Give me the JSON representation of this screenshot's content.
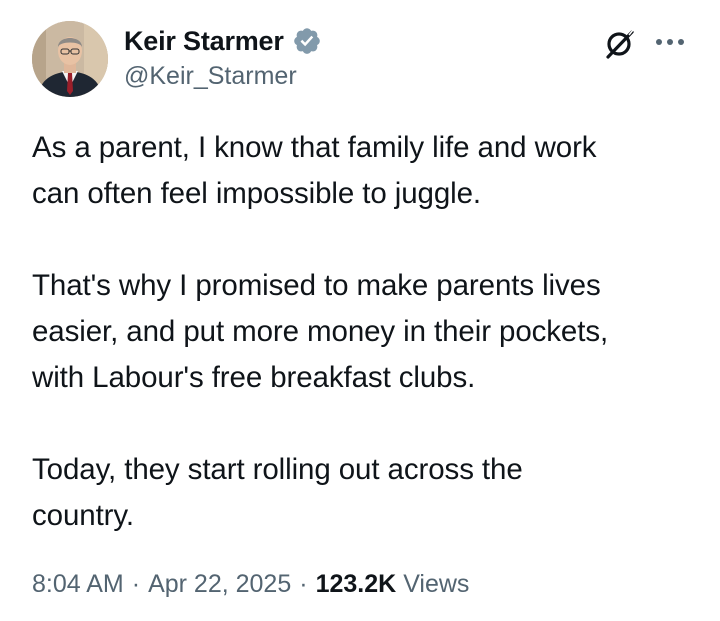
{
  "author": {
    "display_name": "Keir Starmer",
    "handle": "@Keir_Starmer",
    "verified": true,
    "verified_color": "#1d9bf0"
  },
  "tweet": {
    "paragraphs": [
      "As a parent, I know that family life and work\ncan often feel impossible to juggle.",
      "That's why I promised to make parents lives\neasier, and put more money in their pockets,\nwith Labour's free breakfast clubs.",
      "Today, they start rolling out across the\ncountry."
    ]
  },
  "meta": {
    "time": "8:04 AM",
    "separator": "·",
    "date": "Apr 22, 2025",
    "views_count": "123.2K",
    "views_label": "Views"
  },
  "icons": {
    "grok": "grok-icon",
    "more": "more-horizontal-icon",
    "verified": "verified-badge-icon"
  },
  "colors": {
    "text_primary": "#0f1419",
    "text_secondary": "#536471",
    "background": "#ffffff"
  }
}
